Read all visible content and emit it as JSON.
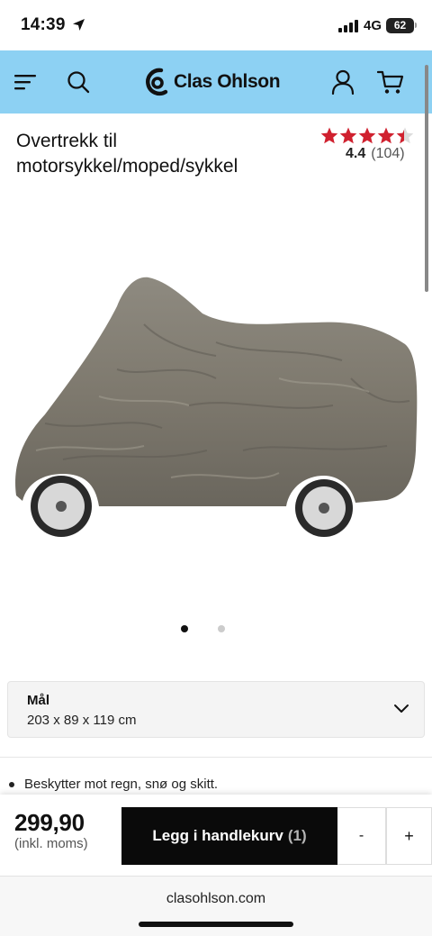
{
  "status_bar": {
    "time": "14:39",
    "network": "4G",
    "battery": "62"
  },
  "header": {
    "brand": "Clas Ohlson",
    "icons": [
      "menu-icon",
      "search-icon",
      "user-icon",
      "cart-icon"
    ],
    "background": "#8dd1f3"
  },
  "product": {
    "title": "Overtrekk til motorsykkel/moped/sykkel",
    "rating": {
      "score": "4.4",
      "count": "(104)",
      "stars_out_of_5": 4.4,
      "star_color": "#d0212f"
    },
    "gallery": {
      "current_index": 1,
      "total_images": 2
    }
  },
  "dimensions": {
    "label": "Mål",
    "value": "203 x 89 x 119 cm"
  },
  "features": [
    "Beskytter mot regn, snø og skitt."
  ],
  "buy_bar": {
    "price": "299,90",
    "price_note": "(inkl. moms)",
    "add_to_cart_label": "Legg i handlekurv",
    "cart_quantity": "(1)",
    "minus_label": "-",
    "plus_label": "+"
  },
  "browser": {
    "url": "clasohlson.com"
  }
}
